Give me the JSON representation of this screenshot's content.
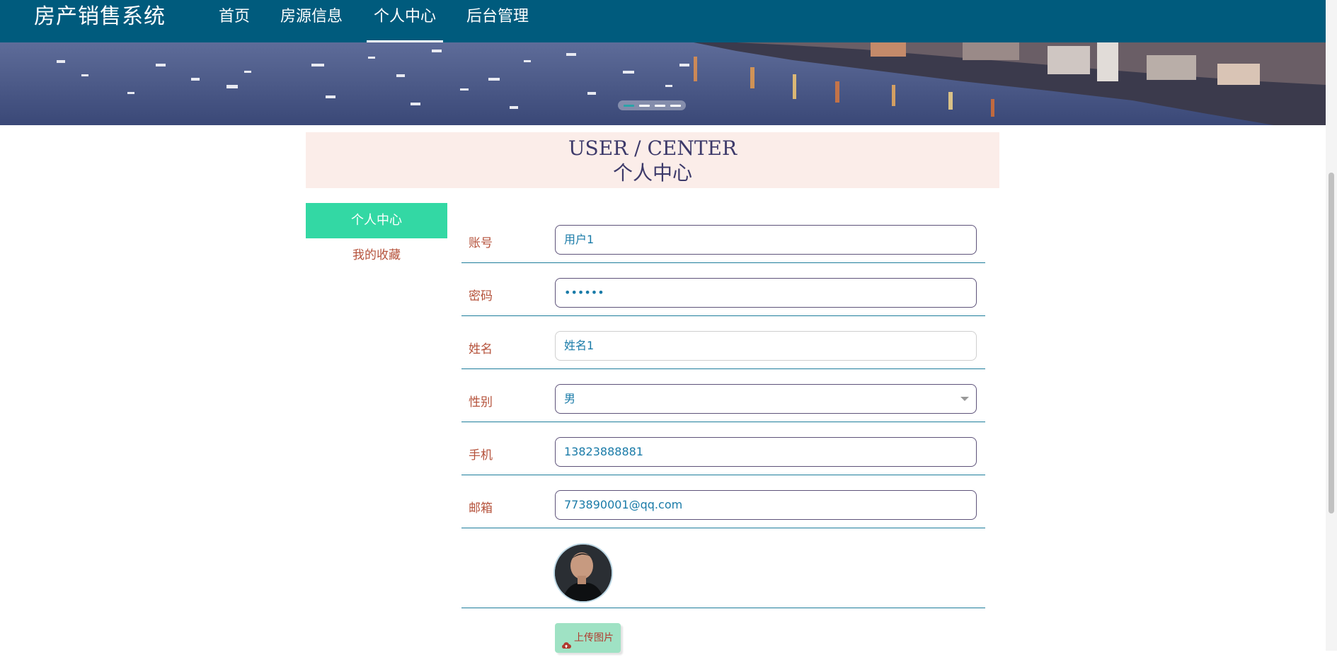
{
  "header": {
    "brand": "房产销售系统",
    "nav": [
      "首页",
      "房源信息",
      "个人中心",
      "后台管理"
    ],
    "active_nav": "个人中心"
  },
  "banner": {
    "slide_count": 4,
    "active_slide": 1
  },
  "section": {
    "title_en": "USER / CENTER",
    "title_cn": "个人中心"
  },
  "sidebar": {
    "items": [
      "个人中心",
      "我的收藏"
    ],
    "active": "个人中心"
  },
  "form": {
    "account_label": "账号",
    "account_value": "用户1",
    "password_label": "密码",
    "password_value": "••••••",
    "name_label": "姓名",
    "name_value": "姓名1",
    "gender_label": "性别",
    "gender_value": "男",
    "phone_label": "手机",
    "phone_value": "13823888881",
    "email_label": "邮箱",
    "email_value": "773890001@qq.com",
    "upload_label": "上传图片"
  },
  "icons": [
    "cloud-upload-icon",
    "chevron-down-icon"
  ],
  "colors": {
    "nav_bg": "#005b7d",
    "sidebar_active": "#33d8a4",
    "label": "#b5523b",
    "input_text": "#1a7ba8",
    "section_bg": "#fbede9",
    "upload_bg": "#9fe2c4"
  }
}
